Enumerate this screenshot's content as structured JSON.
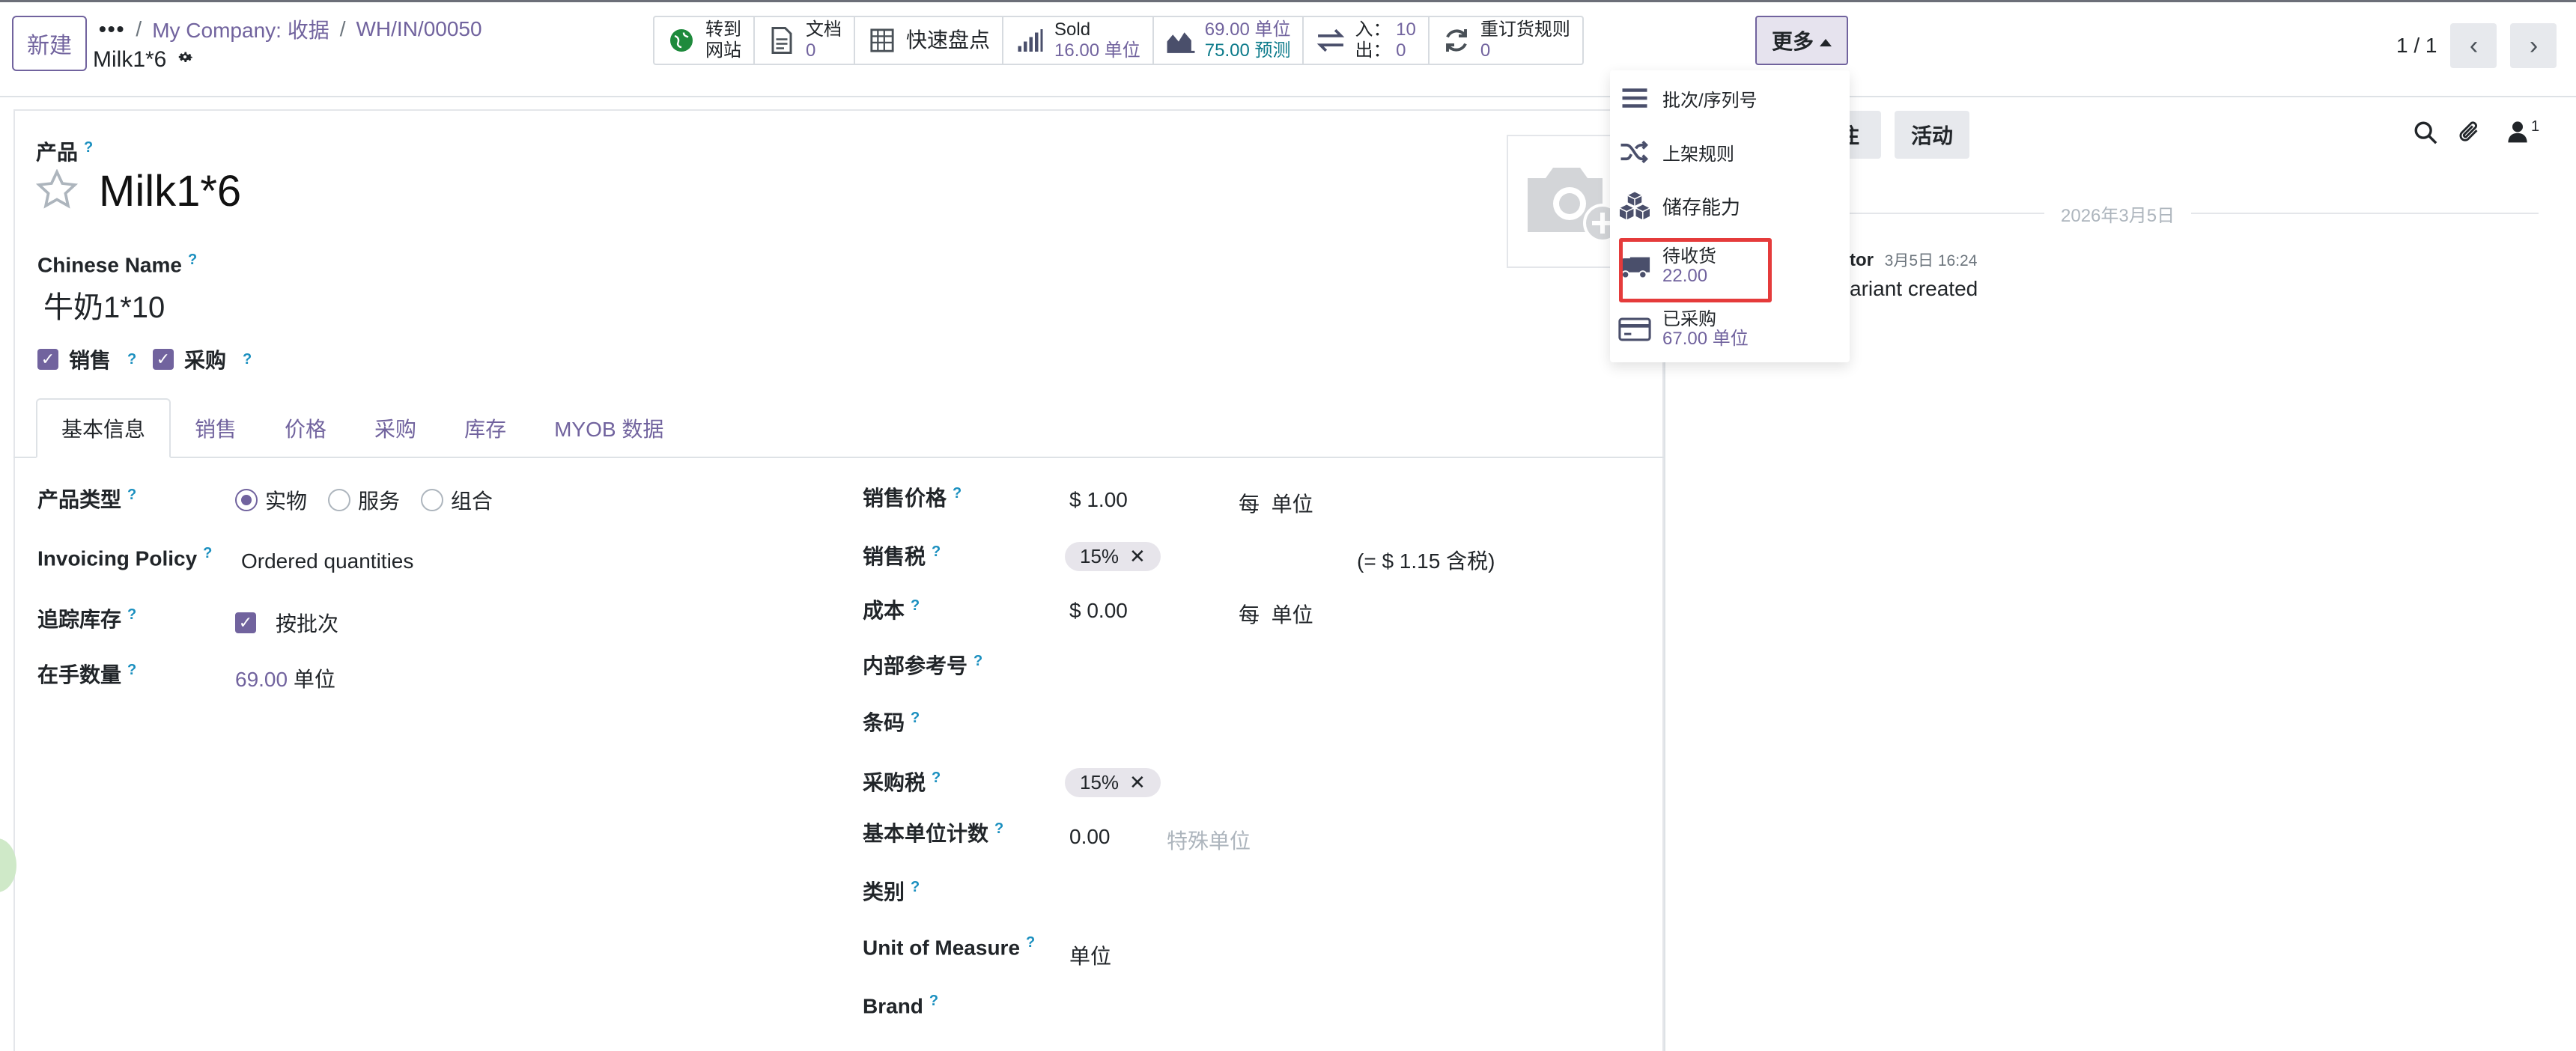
{
  "control_panel": {
    "new_button": "新建",
    "breadcrumb": {
      "dots": "•••",
      "items": [
        "My Company: 收据",
        "WH/IN/00050"
      ]
    },
    "record_title": "Milk1*6"
  },
  "smart_buttons": [
    {
      "icon": "globe-icon",
      "line1": "转到",
      "line2": "网站"
    },
    {
      "icon": "document-icon",
      "line1": "文档",
      "line2": "0"
    },
    {
      "icon": "grid-icon",
      "line1": "快速盘点",
      "line2": ""
    },
    {
      "icon": "bar-signal-icon",
      "line1": "Sold",
      "line2": "16.00 单位"
    },
    {
      "icon": "area-chart-icon",
      "line1": "69.00 单位",
      "line2": "75.00 预测"
    },
    {
      "icon": "arrows-exchange-icon",
      "line1_label": "入：",
      "line1_value": "10",
      "line2_label": "出：",
      "line2_value": "0"
    },
    {
      "icon": "refresh-icon",
      "line1": "重订货规则",
      "line2": "0"
    }
  ],
  "more_button": "更多",
  "pager": {
    "value": "1 / 1"
  },
  "more_dropdown": {
    "items": [
      {
        "icon": "list-icon",
        "label": "批次/序列号"
      },
      {
        "icon": "shuffle-icon",
        "label": "上架规则"
      },
      {
        "icon": "cubes-icon",
        "label": "储存能力"
      },
      {
        "icon": "truck-icon",
        "label": "待收货",
        "value": "22.00"
      },
      {
        "icon": "credit-card-icon",
        "label": "已采购",
        "value": "67.00 单位"
      }
    ]
  },
  "form": {
    "product_label": "产品",
    "product_name": "Milk1*6",
    "chinese_name_label": "Chinese Name",
    "chinese_name_value": "牛奶1*10",
    "sale_ok_label": "销售",
    "purchase_ok_label": "采购",
    "help_mark": "?",
    "tabs": [
      "基本信息",
      "销售",
      "价格",
      "采购",
      "库存",
      "MYOB 数据"
    ],
    "left": {
      "product_type_label": "产品类型",
      "product_type_options": [
        "实物",
        "服务",
        "组合"
      ],
      "invoicing_policy_label": "Invoicing Policy",
      "invoicing_policy_value": "Ordered quantities",
      "tracking_label": "追踪库存",
      "tracking_value": "按批次",
      "on_hand_label": "在手数量",
      "on_hand_value": "69.00",
      "on_hand_unit": "单位"
    },
    "right": {
      "sales_price_label": "销售价格",
      "sales_price_value": "$ 1.00",
      "sales_price_per": "每",
      "sales_price_unit": "单位",
      "sales_tax_label": "销售税",
      "sales_tax_tag": "15%",
      "sales_tax_incl": "(= $ 1.15 含税)",
      "cost_label": "成本",
      "cost_value": "$ 0.00",
      "cost_per": "每",
      "cost_unit": "单位",
      "internal_ref_label": "内部参考号",
      "barcode_label": "条码",
      "purchase_tax_label": "采购税",
      "purchase_tax_tag": "15%",
      "base_unit_count_label": "基本单位计数",
      "base_unit_count_value": "0.00",
      "base_unit_count_placeholder": "特殊单位",
      "category_label": "类别",
      "uom_label": "Unit of Measure",
      "uom_value": "单位",
      "brand_label": "Brand"
    }
  },
  "chatter": {
    "note_button_partial": "注",
    "activity_button": "活动",
    "followers_count": "1",
    "date_separator": "2026年3月5日",
    "message_author_partial": "tor",
    "message_time": "3月5日 16:24",
    "message_body_partial": "ariant created"
  }
}
